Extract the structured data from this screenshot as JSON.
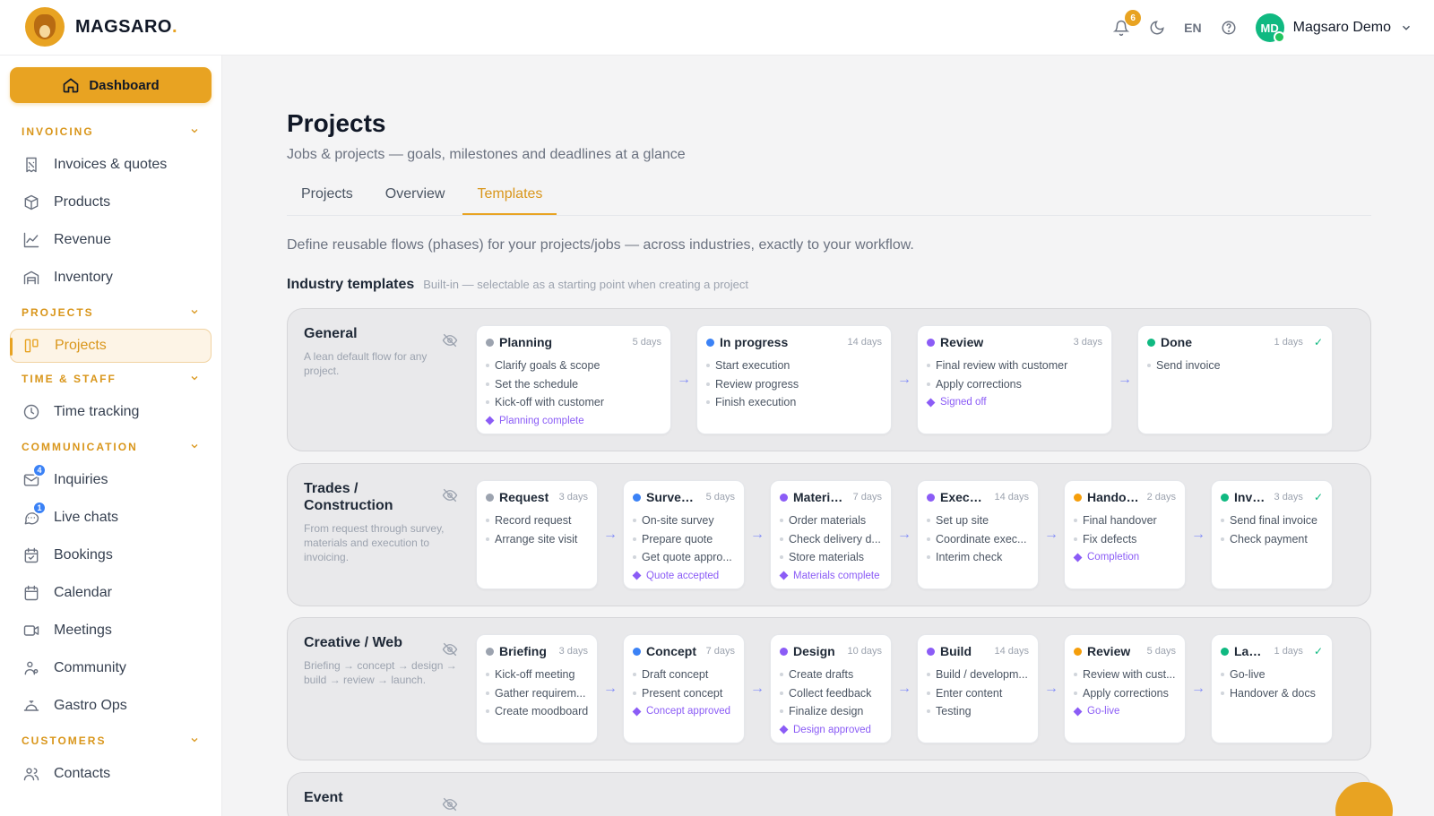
{
  "brand": {
    "name": "MAGSARO",
    "dot": "."
  },
  "header": {
    "notif_count": "6",
    "lang": "EN",
    "user_initials": "MD",
    "user_name": "Magsaro Demo"
  },
  "sidebar": {
    "dashboard": "Dashboard",
    "sections": [
      {
        "title": "INVOICING",
        "items": [
          {
            "label": "Invoices & quotes",
            "icon": "receipt-icon"
          },
          {
            "label": "Products",
            "icon": "box-icon"
          },
          {
            "label": "Revenue",
            "icon": "chart-line-icon"
          },
          {
            "label": "Inventory",
            "icon": "warehouse-icon"
          }
        ]
      },
      {
        "title": "PROJECTS",
        "items": [
          {
            "label": "Projects",
            "icon": "kanban-icon",
            "active": true
          }
        ]
      },
      {
        "title": "TIME & STAFF",
        "items": [
          {
            "label": "Time tracking",
            "icon": "clock-icon"
          }
        ]
      },
      {
        "title": "COMMUNICATION",
        "items": [
          {
            "label": "Inquiries",
            "icon": "mail-icon",
            "badge": "4"
          },
          {
            "label": "Live chats",
            "icon": "chat-icon",
            "badge": "1"
          },
          {
            "label": "Bookings",
            "icon": "calendar-check-icon"
          },
          {
            "label": "Calendar",
            "icon": "calendar-icon"
          },
          {
            "label": "Meetings",
            "icon": "video-icon"
          },
          {
            "label": "Community",
            "icon": "community-icon"
          },
          {
            "label": "Gastro Ops",
            "icon": "cloche-icon"
          }
        ]
      },
      {
        "title": "CUSTOMERS",
        "items": [
          {
            "label": "Contacts",
            "icon": "users-icon"
          }
        ]
      }
    ]
  },
  "main": {
    "title": "Projects",
    "subtitle": "Jobs & projects — goals, milestones and deadlines at a glance",
    "tabs": [
      "Projects",
      "Overview",
      "Templates"
    ],
    "active_tab": 2,
    "description": "Define reusable flows (phases) for your projects/jobs — across industries, exactly to your workflow.",
    "industry_title": "Industry templates",
    "industry_note": "Built-in — selectable as a starting point when creating a project"
  },
  "colors": {
    "accent": "#e8a322",
    "gray": "#9ca3af",
    "blue": "#3b82f6",
    "purple": "#8b5cf6",
    "orange": "#f59e0b",
    "green": "#10b981",
    "milestone": "#8b5cf6"
  },
  "templates": [
    {
      "name": "General",
      "description": "A lean default flow for any project.",
      "phases": [
        {
          "name": "Planning",
          "days": "5 days",
          "color": "gray",
          "items": [
            "Clarify goals & scope",
            "Set the schedule",
            "Kick-off with customer"
          ],
          "milestone": "Planning complete"
        },
        {
          "name": "In progress",
          "days": "14 days",
          "color": "blue",
          "items": [
            "Start execution",
            "Review progress",
            "Finish execution"
          ]
        },
        {
          "name": "Review",
          "days": "3 days",
          "color": "purple",
          "items": [
            "Final review with customer",
            "Apply corrections"
          ],
          "milestone": "Signed off"
        },
        {
          "name": "Done",
          "days": "1 days",
          "color": "green",
          "items": [
            "Send invoice"
          ],
          "done": true
        }
      ]
    },
    {
      "name": "Trades / Construction",
      "description": "From request through survey, materials and execution to invoicing.",
      "phases": [
        {
          "name": "Request",
          "days": "3 days",
          "color": "gray",
          "items": [
            "Record request",
            "Arrange site visit"
          ]
        },
        {
          "name": "Survey ...",
          "days": "5 days",
          "color": "blue",
          "items": [
            "On-site survey",
            "Prepare quote",
            "Get quote appro..."
          ],
          "milestone": "Quote accepted"
        },
        {
          "name": "Materials",
          "days": "7 days",
          "color": "purple",
          "items": [
            "Order materials",
            "Check delivery d...",
            "Store materials"
          ],
          "milestone": "Materials complete"
        },
        {
          "name": "Execut...",
          "days": "14 days",
          "color": "purple",
          "items": [
            "Set up site",
            "Coordinate exec...",
            "Interim check"
          ]
        },
        {
          "name": "Handover",
          "days": "2 days",
          "color": "orange",
          "items": [
            "Final handover",
            "Fix defects"
          ],
          "milestone": "Completion"
        },
        {
          "name": "Invo...",
          "days": "3 days",
          "color": "green",
          "items": [
            "Send final invoice",
            "Check payment"
          ],
          "done": true
        }
      ]
    },
    {
      "name": "Creative / Web",
      "description": "Briefing → concept → design → build → review → launch.",
      "phases": [
        {
          "name": "Briefing",
          "days": "3 days",
          "color": "gray",
          "items": [
            "Kick-off meeting",
            "Gather requirem...",
            "Create moodboard"
          ]
        },
        {
          "name": "Concept",
          "days": "7 days",
          "color": "blue",
          "items": [
            "Draft concept",
            "Present concept"
          ],
          "milestone": "Concept approved"
        },
        {
          "name": "Design",
          "days": "10 days",
          "color": "purple",
          "items": [
            "Create drafts",
            "Collect feedback",
            "Finalize design"
          ],
          "milestone": "Design approved"
        },
        {
          "name": "Build",
          "days": "14 days",
          "color": "purple",
          "items": [
            "Build / developm...",
            "Enter content",
            "Testing"
          ]
        },
        {
          "name": "Review",
          "days": "5 days",
          "color": "orange",
          "items": [
            "Review with cust...",
            "Apply corrections"
          ],
          "milestone": "Go-live"
        },
        {
          "name": "Laun...",
          "days": "1 days",
          "color": "green",
          "items": [
            "Go-live",
            "Handover & docs"
          ],
          "done": true
        }
      ]
    },
    {
      "name": "Event",
      "description": "",
      "phases": []
    }
  ]
}
